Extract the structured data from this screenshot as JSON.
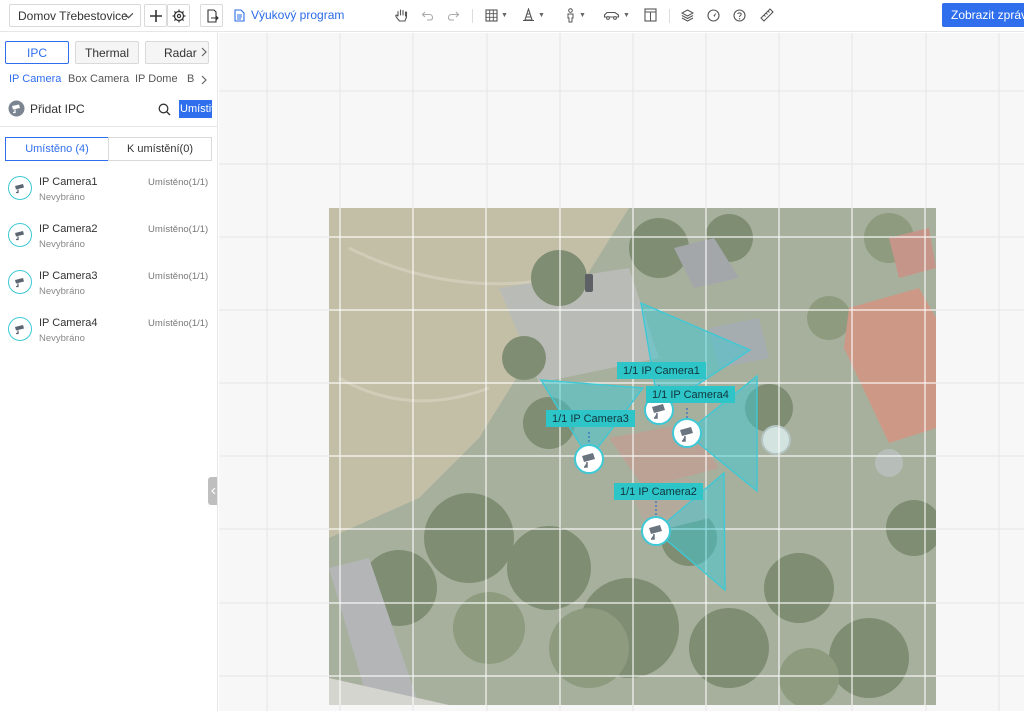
{
  "toolbar": {
    "site_name": "Domov Třebestovice",
    "tutorial_label": "Výukový program",
    "report_button": "Zobrazit zprávu"
  },
  "sidebar": {
    "type_tabs": [
      "IPC",
      "Thermal",
      "Radar"
    ],
    "sub_tabs": [
      "IP Camera",
      "Box Camera",
      "IP Dome",
      "B"
    ],
    "add_label": "Přidat IPC",
    "place_button": "Umístit",
    "segments": [
      "Umístěno (4)",
      "K umístění(0)"
    ],
    "cameras": [
      {
        "name": "IP Camera1",
        "sub": "Nevybráno",
        "status": "Umístěno(1/1)"
      },
      {
        "name": "IP Camera2",
        "sub": "Nevybráno",
        "status": "Umístěno(1/1)"
      },
      {
        "name": "IP Camera3",
        "sub": "Nevybráno",
        "status": "Umístěno(1/1)"
      },
      {
        "name": "IP Camera4",
        "sub": "Nevybráno",
        "status": "Umístěno(1/1)"
      }
    ]
  },
  "map": {
    "camera_labels": [
      "1/1 IP Camera1",
      "1/1 IP Camera4",
      "1/1 IP Camera3",
      "1/1 IP Camera2"
    ]
  },
  "colors": {
    "accent": "#2f6fed",
    "fov": "#3ec9d6",
    "label_bg": "#2ec5c9"
  }
}
